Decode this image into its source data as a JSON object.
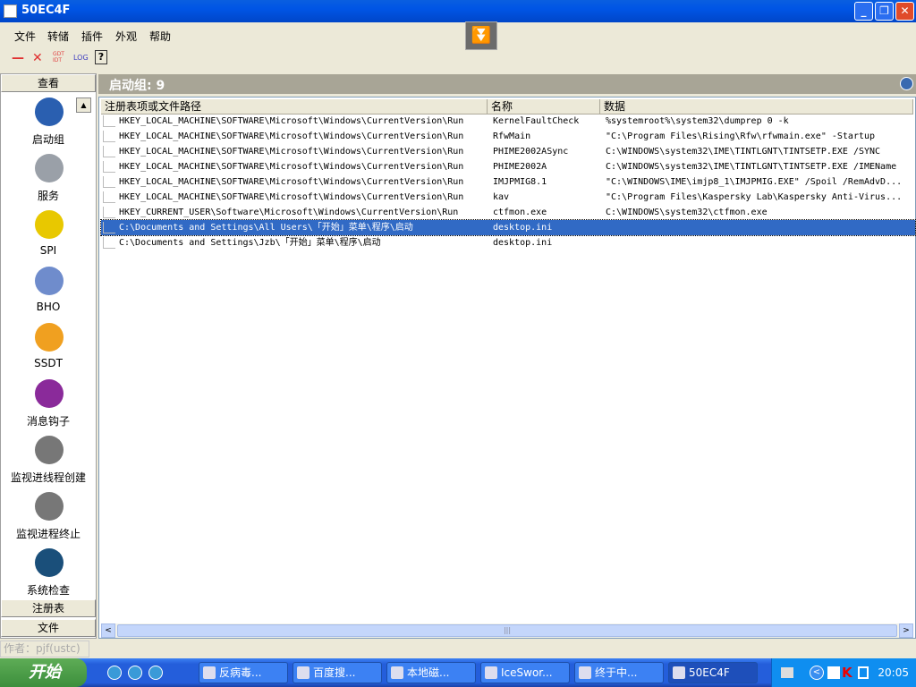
{
  "window": {
    "title": "50EC4F"
  },
  "menu": [
    "文件",
    "转储",
    "插件",
    "外观",
    "帮助"
  ],
  "toolbar": {
    "minus": "—",
    "delete": "✕",
    "gdt_idt": "GDT IDT",
    "log": "LOG",
    "help": "?"
  },
  "sidebar": {
    "header": "查看",
    "items": [
      {
        "label": "启动组",
        "icon": "startup-globe-icon",
        "color": "#2a5fb0"
      },
      {
        "label": "服务",
        "icon": "computer-icon",
        "color": "#9aa0a8"
      },
      {
        "label": "SPI",
        "icon": "warning-icon",
        "color": "#e8c800"
      },
      {
        "label": "BHO",
        "icon": "folder-globe-icon",
        "color": "#6f8ccc"
      },
      {
        "label": "SSDT",
        "icon": "bell-icon",
        "color": "#f0a020"
      },
      {
        "label": "消息钩子",
        "icon": "hook-icon",
        "color": "#8a2a9a"
      },
      {
        "label": "监视进线程创建",
        "icon": "monitor-create-icon",
        "color": "#777"
      },
      {
        "label": "监视进程终止",
        "icon": "monitor-terminate-icon",
        "color": "#777"
      },
      {
        "label": "系统检查",
        "icon": "system-check-icon",
        "color": "#1a4f7a"
      }
    ],
    "footer": [
      "注册表",
      "文件"
    ]
  },
  "main": {
    "title": "启动组: 9",
    "columns": [
      "注册表项或文件路径",
      "名称",
      "数据"
    ],
    "rows": [
      [
        "HKEY_LOCAL_MACHINE\\SOFTWARE\\Microsoft\\Windows\\CurrentVersion\\Run",
        "KernelFaultCheck",
        "%systemroot%\\system32\\dumprep 0 -k"
      ],
      [
        "HKEY_LOCAL_MACHINE\\SOFTWARE\\Microsoft\\Windows\\CurrentVersion\\Run",
        "RfwMain",
        "\"C:\\Program Files\\Rising\\Rfw\\rfwmain.exe\" -Startup"
      ],
      [
        "HKEY_LOCAL_MACHINE\\SOFTWARE\\Microsoft\\Windows\\CurrentVersion\\Run",
        "PHIME2002ASync",
        "C:\\WINDOWS\\system32\\IME\\TINTLGNT\\TINTSETP.EXE /SYNC"
      ],
      [
        "HKEY_LOCAL_MACHINE\\SOFTWARE\\Microsoft\\Windows\\CurrentVersion\\Run",
        "PHIME2002A",
        "C:\\WINDOWS\\system32\\IME\\TINTLGNT\\TINTSETP.EXE /IMEName"
      ],
      [
        "HKEY_LOCAL_MACHINE\\SOFTWARE\\Microsoft\\Windows\\CurrentVersion\\Run",
        "IMJPMIG8.1",
        "\"C:\\WINDOWS\\IME\\imjp8_1\\IMJPMIG.EXE\" /Spoil /RemAdvD..."
      ],
      [
        "HKEY_LOCAL_MACHINE\\SOFTWARE\\Microsoft\\Windows\\CurrentVersion\\Run",
        "kav",
        "\"C:\\Program Files\\Kaspersky Lab\\Kaspersky Anti-Virus..."
      ],
      [
        "HKEY_CURRENT_USER\\Software\\Microsoft\\Windows\\CurrentVersion\\Run",
        "ctfmon.exe",
        "C:\\WINDOWS\\system32\\ctfmon.exe"
      ],
      [
        "C:\\Documents and Settings\\All Users\\「开始」菜单\\程序\\启动",
        "desktop.ini",
        ""
      ],
      [
        "C:\\Documents and Settings\\Jzb\\「开始」菜单\\程序\\启动",
        "desktop.ini",
        ""
      ]
    ],
    "selected_row": 7
  },
  "status": "作者：pjf(ustc)",
  "taskbar": {
    "start": "开始",
    "tasks": [
      "反病毒...",
      "百度搜...",
      "本地磁...",
      "IceSwor...",
      "终于中...",
      "50EC4F"
    ],
    "active_task": 5,
    "clock": "20:05"
  }
}
